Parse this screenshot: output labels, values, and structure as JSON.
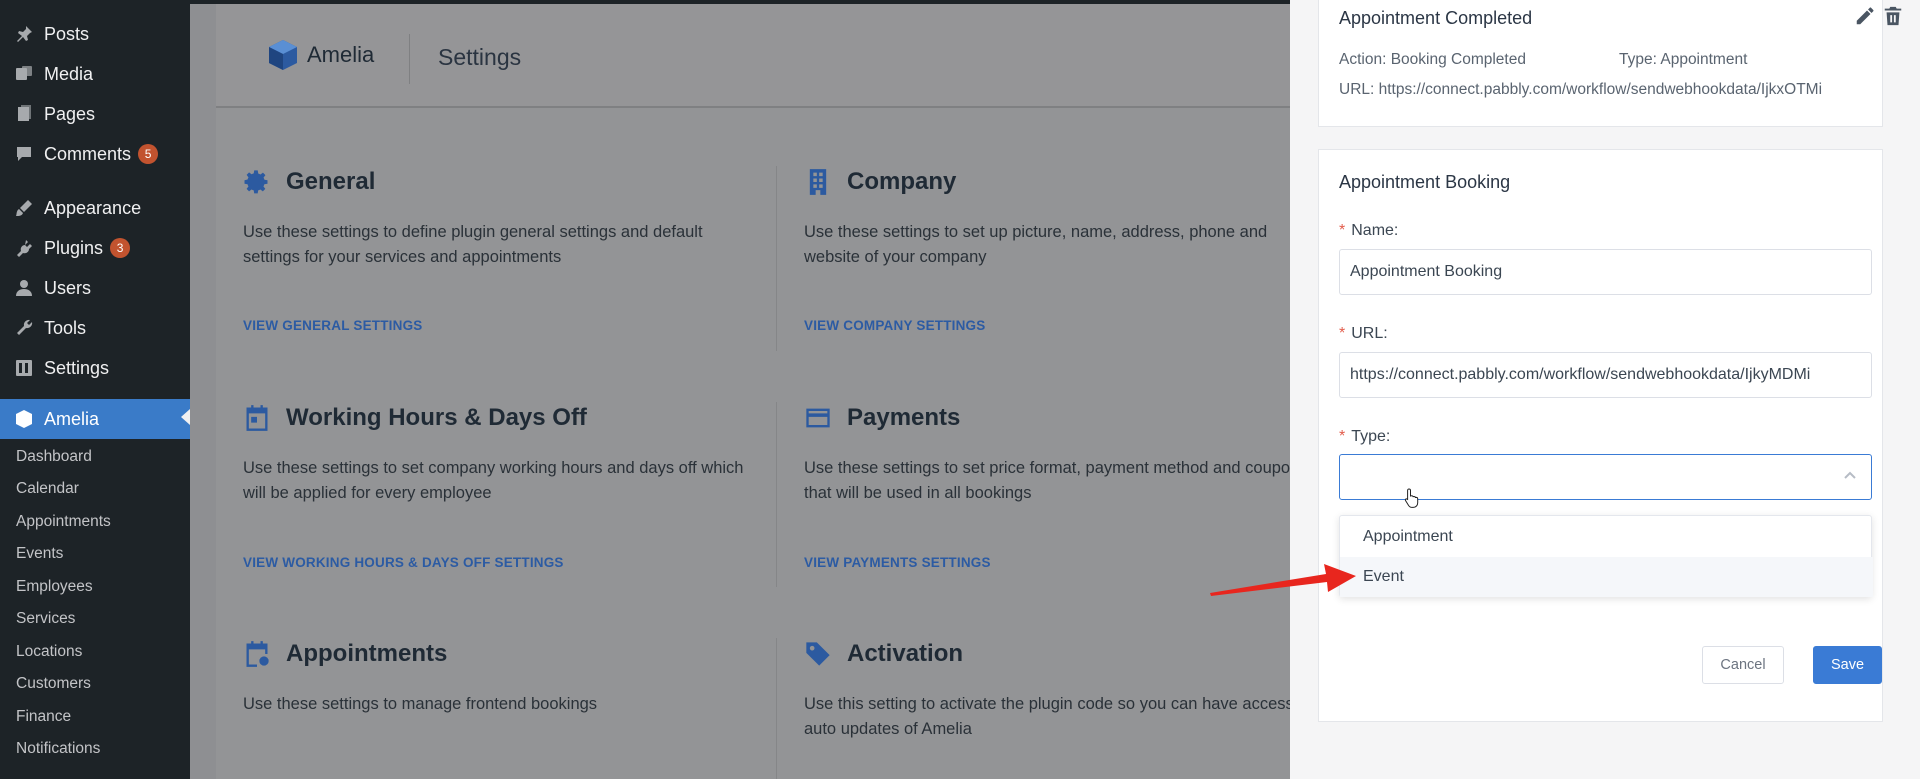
{
  "sidebar": {
    "items": [
      {
        "label": "Posts",
        "icon": "pushpin-icon"
      },
      {
        "label": "Media",
        "icon": "media-icon"
      },
      {
        "label": "Pages",
        "icon": "pages-icon"
      },
      {
        "label": "Comments",
        "icon": "comment-icon",
        "badge": "5"
      },
      {
        "label": "Appearance",
        "icon": "paintbrush-icon"
      },
      {
        "label": "Plugins",
        "icon": "plugin-icon",
        "badge": "3"
      },
      {
        "label": "Users",
        "icon": "user-icon"
      },
      {
        "label": "Tools",
        "icon": "wrench-icon"
      },
      {
        "label": "Settings",
        "icon": "settings-icon"
      },
      {
        "label": "Amelia",
        "icon": "amelia-icon",
        "active": true
      }
    ],
    "submenu": [
      "Dashboard",
      "Calendar",
      "Appointments",
      "Events",
      "Employees",
      "Services",
      "Locations",
      "Customers",
      "Finance",
      "Notifications"
    ]
  },
  "header": {
    "logo_text": "Amelia",
    "title": "Settings"
  },
  "cards": {
    "general": {
      "title": "General",
      "desc": "Use these settings to define plugin general settings and default settings for your services and appointments",
      "link": "VIEW GENERAL SETTINGS"
    },
    "company": {
      "title": "Company",
      "desc": "Use these settings to set up picture, name, address, phone and website of your company",
      "link": "VIEW COMPANY SETTINGS"
    },
    "working": {
      "title": "Working Hours & Days Off",
      "desc": "Use these settings to set company working hours and days off which will be applied for every employee",
      "link": "VIEW WORKING HOURS & DAYS OFF SETTINGS"
    },
    "payments": {
      "title": "Payments",
      "desc": "Use these settings to set price format, payment method and coupons that will be used in all bookings",
      "link": "VIEW PAYMENTS SETTINGS"
    },
    "appointments": {
      "title": "Appointments",
      "desc": "Use these settings to manage frontend bookings"
    },
    "activation": {
      "title": "Activation",
      "desc": "Use this setting to activate the plugin code so you can have access to auto updates of Amelia"
    }
  },
  "panel": {
    "completed": {
      "title": "Appointment Completed",
      "action": "Action: Booking Completed",
      "type": "Type: Appointment",
      "url": "URL: https://connect.pabbly.com/workflow/sendwebhookdata/IjkxOTMi"
    },
    "booking": {
      "title": "Appointment Booking",
      "name_label": "Name:",
      "name_value": "Appointment Booking",
      "url_label": "URL:",
      "url_value": "https://connect.pabbly.com/workflow/sendwebhookdata/IjkyMDMi",
      "type_label": "Type:",
      "type_value": "",
      "options": [
        "Appointment",
        "Event"
      ],
      "cancel_label": "Cancel",
      "save_label": "Save"
    }
  },
  "colors": {
    "accent": "#3a7bd5",
    "sidebar_bg": "#1d2327",
    "annotation_arrow": "#e8261e"
  }
}
